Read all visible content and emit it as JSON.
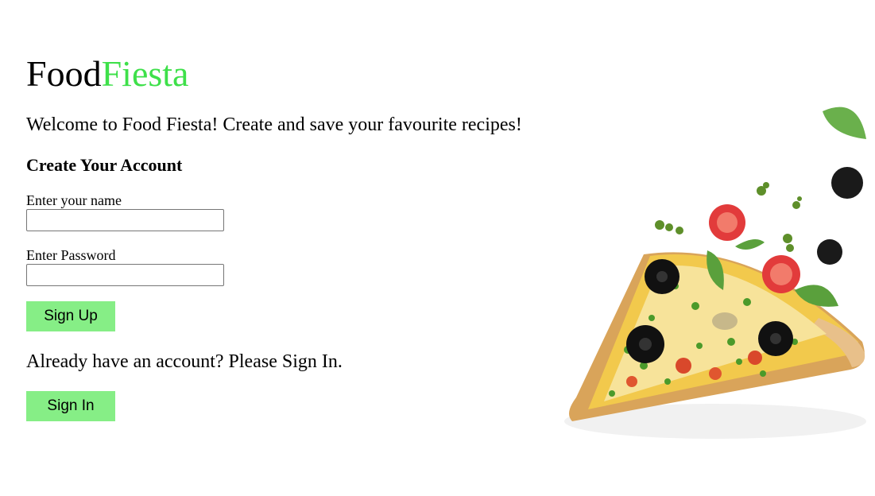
{
  "brand": {
    "part1": "Food",
    "part2": "Fiesta",
    "accent_color": "#3ee04a"
  },
  "welcome_text": "Welcome to Food Fiesta! Create and save your favourite recipes!",
  "signup_form": {
    "title": "Create Your Account",
    "name_label": "Enter your name",
    "name_value": "",
    "password_label": "Enter Password",
    "password_value": "",
    "signup_button": "Sign Up"
  },
  "signin_section": {
    "prompt": "Already have an account? Please Sign In.",
    "signin_button": "Sign In"
  },
  "colors": {
    "button_bg": "#86ee86"
  },
  "hero_image": {
    "subject": "pizza-slice-illustration"
  }
}
